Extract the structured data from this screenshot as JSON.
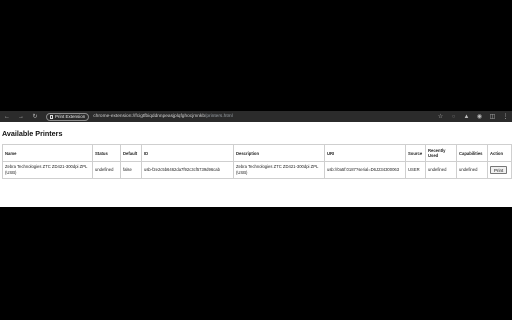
{
  "browser": {
    "extension_chip": "Print Extension",
    "url_scheme": "chrome-extension://",
    "url_host": "fcigtfbiqddnnpeasjplqfghocjmnkb",
    "url_path": "/printers.html",
    "nav_icons": [
      "back-icon",
      "forward-icon",
      "reload-icon"
    ],
    "right_icons": [
      "star-icon",
      "extension-icon",
      "puzzle-icon",
      "profile-icon",
      "sidepanel-icon",
      "menu-icon"
    ]
  },
  "page": {
    "title": "Available Printers",
    "columns": [
      "Name",
      "Status",
      "Default",
      "ID",
      "Description",
      "URI",
      "Source",
      "Recently Used",
      "Capabilities",
      "Action"
    ],
    "rows": [
      {
        "name": "Zebra Technologies ZTC ZD421-300dpi ZPL (USB)",
        "status": "undefined",
        "default": "false",
        "id": "usb-f2e2c5b6462da7f92c3cf5739d96cab",
        "description": "Zebra Technologies ZTC ZD421-300dpi ZPL (USB)",
        "uri": "usb://0a5f:0187?serial=D6J234300063",
        "source": "USER",
        "recently_used": "undefined",
        "capabilities": "undefined",
        "action": "Print"
      }
    ]
  }
}
